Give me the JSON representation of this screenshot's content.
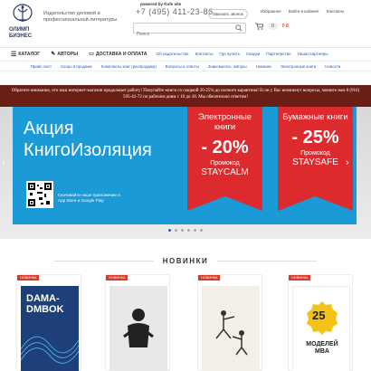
{
  "header": {
    "logo_text": "ОЛИМП\nБИЗНЕС",
    "tagline": "Издательство деловой и профессиональной литературы",
    "powered_by": "powered by Kofe site",
    "phone": "+7 (495) 411-23-86",
    "callback_label": "Заказать звонок",
    "top_links": [
      "Избранное",
      "Войти в кабинет",
      "Контакты"
    ],
    "search_placeholder": "Поиск",
    "cart_count": "0",
    "cart_total": "0   ₽."
  },
  "nav": {
    "primary": [
      "КАТАЛОГ",
      "АВТОРЫ",
      "ДОСТАВКА И ОПЛАТА"
    ],
    "sublinks": [
      "Об издательстве",
      "Контакты",
      "Где купить",
      "Скидки",
      "Партнерство",
      "Наши партнеры"
    ],
    "secondary": [
      "Прайс-лист",
      "Скоро в продаже",
      "Комплекты книг (распродажа)",
      "Вопросы и ответы",
      "Знакомьтесь: авторы",
      "Новинки",
      "Электронные книги",
      "Новости"
    ]
  },
  "notice": "Обратите внимание, что наш интернет-магазин продолжает работу! Покупайте книги со скидкой 20-25% до полного карантина! Если у Вас возникнут вопросы, звоните нам 8 (916) 595-42-72 по рабочим дням с 10 до 18. Мы обязательно ответим!",
  "banner": {
    "heading_1": "Акция",
    "heading_2": "КнигоИзоляция",
    "qr_text": "Скачивайте наше приложение в App Store и Google Play",
    "promos": [
      {
        "title": "Электронные книги",
        "percent": "- 20%",
        "code_label": "Промокод",
        "code": "STAYCALM"
      },
      {
        "title": "Бумажные книги",
        "percent": "- 25%",
        "code_label": "Промокод",
        "code": "STAYSAFE"
      }
    ],
    "slides": 6,
    "active_slide": 1
  },
  "new_items": {
    "title": "НОВИНКИ",
    "books": [
      {
        "tag": "НОВИНКА",
        "cover_title": "DAMA-\nDMBOK",
        "cover_subtitle": "",
        "cover_bg": "#1d3f7a"
      },
      {
        "tag": "НОВИНКА",
        "cover_title": "",
        "cover_subtitle": "",
        "cover_bg": "#e8e8e8"
      },
      {
        "tag": "НОВИНКА",
        "cover_title": "",
        "cover_subtitle": "",
        "cover_bg": "#f2efe8"
      },
      {
        "tag": "НОВИНКА",
        "cover_title": "25",
        "cover_subtitle": "МОДЕЛЕЙ\nMBA",
        "cover_bg": "#ffffff"
      }
    ]
  },
  "colors": {
    "accent_blue": "#1a9ad6",
    "promo_red": "#dd2a2e",
    "notice_bg": "#6b1f14",
    "link_blue": "#2b5ea7"
  }
}
